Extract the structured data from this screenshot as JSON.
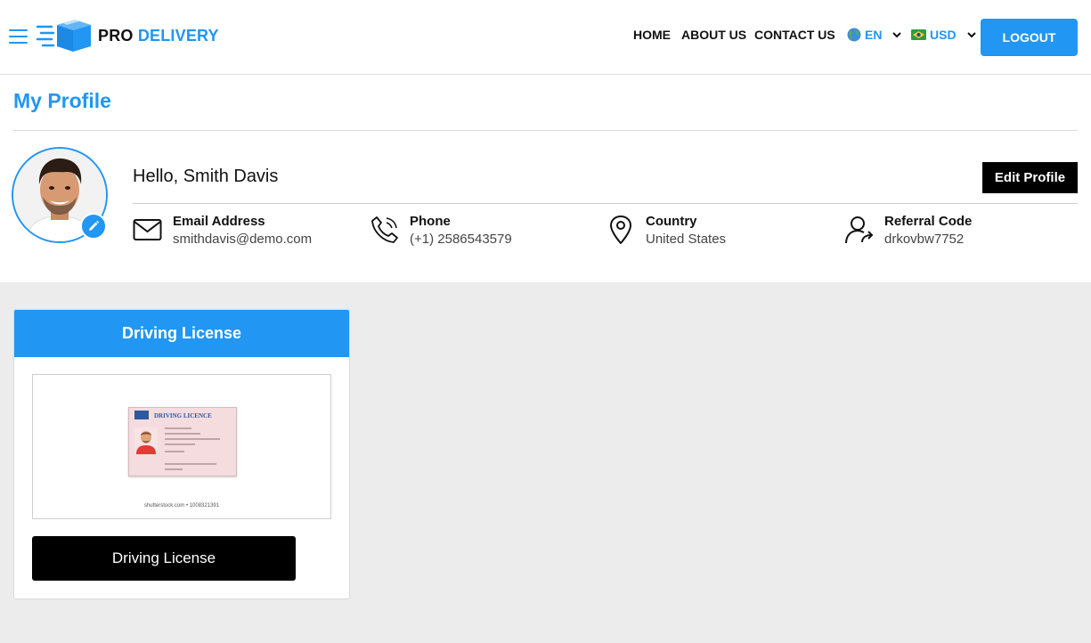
{
  "brand": {
    "pro": "PRO",
    "delivery": "DELIVERY"
  },
  "nav": {
    "home": "HOME",
    "about": "ABOUT US",
    "contact": "CONTACT US"
  },
  "language": {
    "label": "EN",
    "icon": "globe-icon"
  },
  "currency": {
    "label": "USD",
    "icon": "flag-icon"
  },
  "logout_label": "LOGOUT",
  "page_title": "My Profile",
  "profile": {
    "greeting": "Hello, Smith Davis",
    "edit_label": "Edit Profile",
    "email": {
      "label": "Email Address",
      "value": "smithdavis@demo.com"
    },
    "phone": {
      "label": "Phone",
      "value": "(+1) 2586543579"
    },
    "country": {
      "label": "Country",
      "value": "United States"
    },
    "referral": {
      "label": "Referral Code",
      "value": "drkovbw7752"
    }
  },
  "document_card": {
    "title": "Driving License",
    "image_heading": "DRIVING LICENCE",
    "image_caption": "shutterstock.com • 1008321391",
    "button_label": "Driving License"
  },
  "colors": {
    "accent": "#2196f3",
    "dark": "#000000",
    "page_bg": "#ececec"
  }
}
